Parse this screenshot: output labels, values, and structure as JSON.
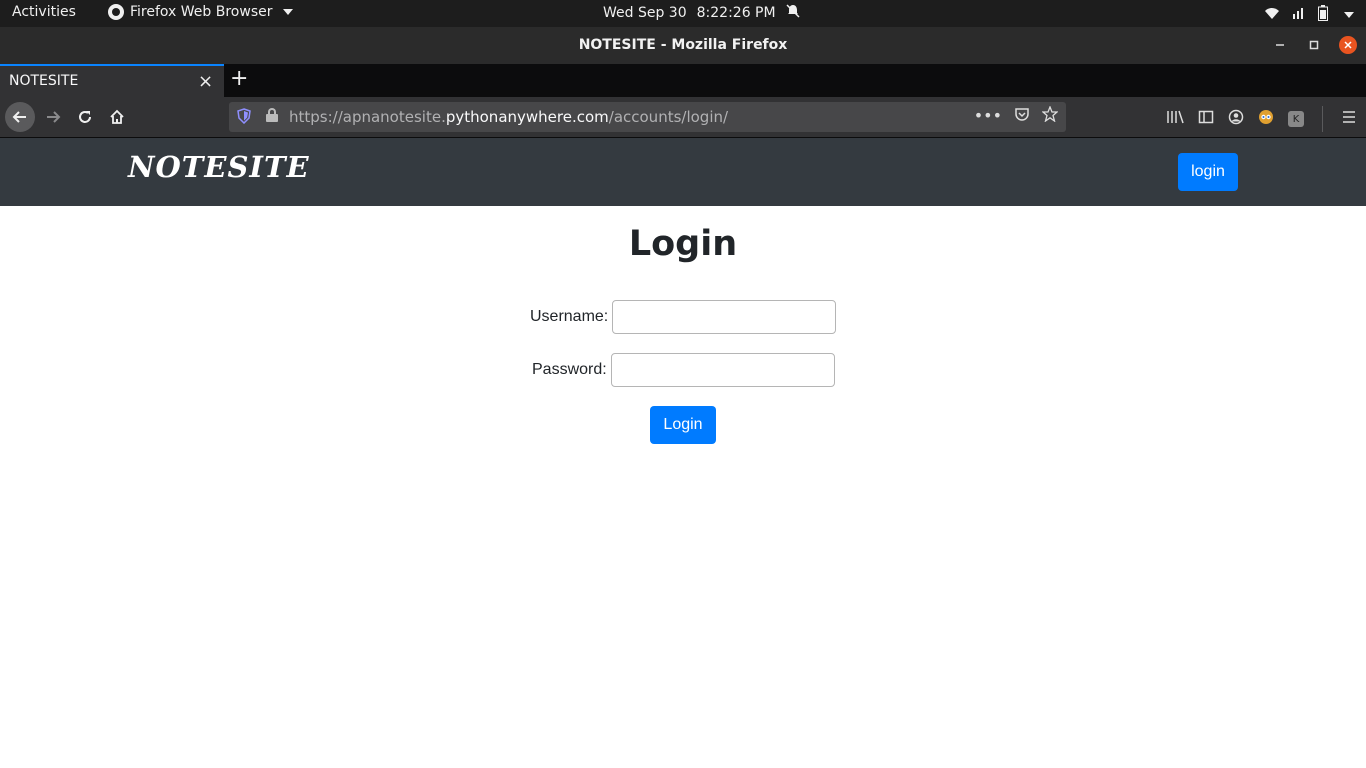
{
  "system_bar": {
    "activities": "Activities",
    "app_name": "Firefox Web Browser",
    "date": "Wed Sep 30",
    "time": "8:22:26 PM"
  },
  "window": {
    "title": "NOTESITE - Mozilla Firefox"
  },
  "tabs": [
    {
      "label": "NOTESITE",
      "active": true
    }
  ],
  "urlbar": {
    "prefix": "https://apnanotesite.",
    "host": "pythonanywhere.com",
    "path": "/accounts/login/"
  },
  "site": {
    "brand": "NOTESITE",
    "nav_login": "login",
    "accent_color": "#007bff",
    "navbar_color": "#343a40"
  },
  "form": {
    "title": "Login",
    "username_label": "Username:",
    "username_value": "",
    "password_label": "Password:",
    "password_value": "",
    "submit_label": "Login"
  }
}
